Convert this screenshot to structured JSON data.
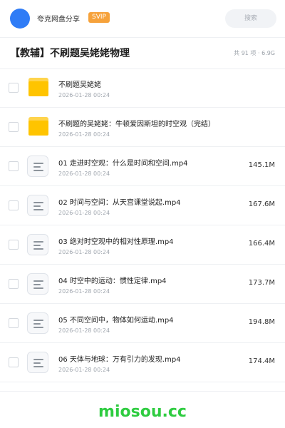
{
  "header": {
    "site_name": "夸克网盘分享",
    "badge": "SVIP",
    "search_placeholder": "搜索",
    "avatar_color": "#2f7cf6"
  },
  "share": {
    "title": "【教辅】不刷题吴姥姥物理",
    "meta": "共 91 项 · 6.9G"
  },
  "files": [
    {
      "type": "folder",
      "icon": "folder-icon",
      "name": "不刷题吴姥姥",
      "date": "2026-01-28 00:24",
      "size": ""
    },
    {
      "type": "folder",
      "icon": "folder-icon",
      "name": "不刷题的吴姥姥：牛顿爱因斯坦的时空观（完结）",
      "date": "2026-01-28 00:24",
      "size": ""
    },
    {
      "type": "video",
      "icon": "video-file-icon",
      "name": "01 走进时空观：什么是时间和空间.mp4",
      "date": "2026-01-28 00:24",
      "size": "145.1M"
    },
    {
      "type": "video",
      "icon": "video-file-icon",
      "name": "02 时间与空间：从天宫课堂说起.mp4",
      "date": "2026-01-28 00:24",
      "size": "167.6M"
    },
    {
      "type": "video",
      "icon": "video-file-icon",
      "name": "03 绝对时空观中的相对性原理.mp4",
      "date": "2026-01-28 00:24",
      "size": "166.4M"
    },
    {
      "type": "video",
      "icon": "video-file-icon",
      "name": "04 时空中的运动：惯性定律.mp4",
      "date": "2026-01-28 00:24",
      "size": "173.7M"
    },
    {
      "type": "video",
      "icon": "video-file-icon",
      "name": "05 不同空间中，物体如何运动.mp4",
      "date": "2026-01-28 00:24",
      "size": "194.8M"
    },
    {
      "type": "video",
      "icon": "video-file-icon",
      "name": "06 天体与地球：万有引力的发现.mp4",
      "date": "2026-01-28 00:24",
      "size": "174.4M"
    }
  ],
  "footer": {
    "brand": "miosou.cc",
    "brand_color": "#2ecc40"
  }
}
